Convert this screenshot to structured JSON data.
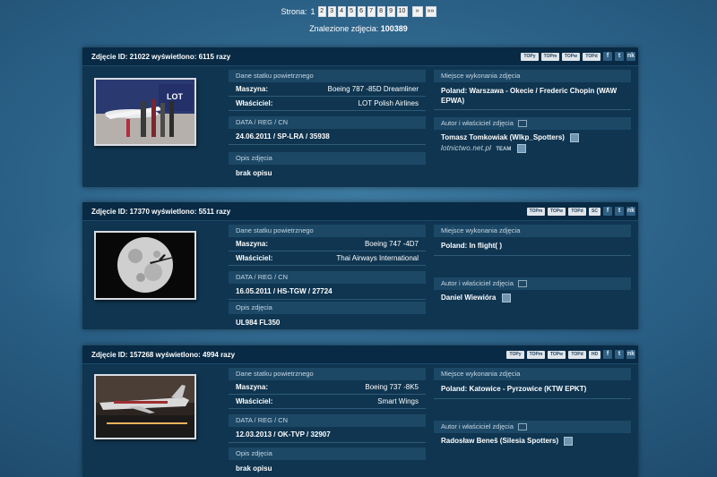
{
  "pager": {
    "label": "Strona:",
    "current": "1",
    "pages": [
      "2",
      "3",
      "4",
      "5",
      "6",
      "7",
      "8",
      "9",
      "10"
    ],
    "next": "»",
    "last": "»»"
  },
  "found": {
    "label": "Znalezione zdjęcia:",
    "value": "100389"
  },
  "photos": [
    {
      "header": "Zdjęcie ID: 21022 wyświetlono: 6115 razy",
      "buttons": [
        "TOPy",
        "TOPm",
        "TOPw",
        "TOPd"
      ],
      "social": [
        "f",
        "t",
        "nk"
      ],
      "aircraft_section": "Dane statku powietrznego",
      "machine_label": "Maszyna:",
      "machine": "Boeing 787 -85D Dreamliner",
      "owner_label": "Właściciel:",
      "owner": "LOT Polish Airlines",
      "data_section": "DATA / REG / CN",
      "data": "24.06.2011 / SP-LRA / 35938",
      "desc_section": "Opis zdjęcia",
      "desc": "brak opisu",
      "place_section": "Miejsce wykonania zdjęcia",
      "place": "Poland: Warszawa - Okecie / Frederic Chopin (WAW EPWA)",
      "author_section": "Autor i właściciel zdjęcia",
      "author": "Tomasz Tomkowiak (Wlkp_Spotters)",
      "logo": "lotnictwo.net.pl",
      "team": "TEAM"
    },
    {
      "header": "Zdjęcie ID: 17370 wyświetlono: 5511 razy",
      "buttons": [
        "TOPm",
        "TOPw",
        "TOPd",
        "SC"
      ],
      "social": [
        "f",
        "t",
        "nk"
      ],
      "aircraft_section": "Dane statku powietrznego",
      "machine_label": "Maszyna:",
      "machine": "Boeing 747 -4D7",
      "owner_label": "Właściciel:",
      "owner": "Thai Airways International",
      "data_section": "DATA / REG / CN",
      "data": "16.05.2011 / HS-TGW / 27724",
      "desc_section": "Opis zdjęcia",
      "desc": "UL984 FL350",
      "place_section": "Miejsce wykonania zdjęcia",
      "place": "Poland: In flight( )",
      "author_section": "Autor i właściciel zdjęcia",
      "author": "Daniel Wiewióra"
    },
    {
      "header": "Zdjęcie ID: 157268 wyświetlono: 4994 razy",
      "buttons": [
        "TOPy",
        "TOPm",
        "TOPw",
        "TOPd",
        "HD"
      ],
      "social": [
        "f",
        "t",
        "nk"
      ],
      "aircraft_section": "Dane statku powietrznego",
      "machine_label": "Maszyna:",
      "machine": "Boeing 737 -8K5",
      "owner_label": "Właściciel:",
      "owner": "Smart Wings",
      "data_section": "DATA / REG / CN",
      "data": "12.03.2013 / OK-TVP / 32907",
      "desc_section": "Opis zdjęcia",
      "desc": "brak opisu",
      "place_section": "Miejsce wykonania zdjęcia",
      "place": "Poland: Katowice - Pyrzowice (KTW EPKT)",
      "author_section": "Autor i właściciel zdjęcia",
      "author": "Radosław Beneš (Silesia Spotters)"
    }
  ]
}
